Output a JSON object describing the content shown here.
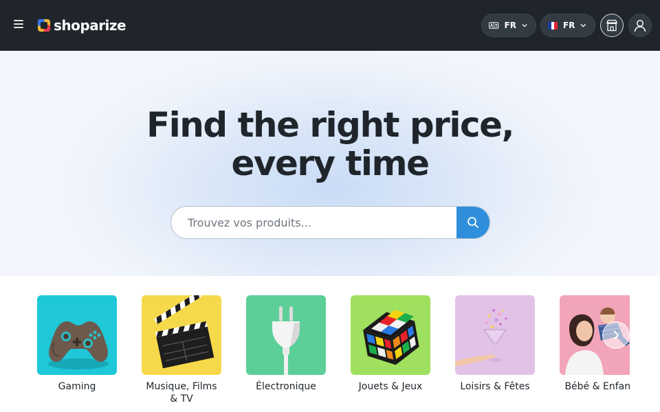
{
  "header": {
    "logo_text": "shoparize",
    "language": {
      "code": "FR",
      "icon": "translate-icon"
    },
    "country": {
      "code": "FR",
      "flag_colors": [
        "#1f3c9c",
        "#ffffff",
        "#e0242f"
      ]
    },
    "store_icon": "store-icon",
    "account_icon": "user-icon",
    "menu_icon": "hamburger-icon"
  },
  "hero": {
    "title_line1": "Find the right price,",
    "title_line2": "every time",
    "search_placeholder": "Trouvez vos produits...",
    "search_icon": "search-icon"
  },
  "categories": [
    {
      "label": "Gaming",
      "tile_color": "#1ec8d8",
      "icon": "gamepad-icon"
    },
    {
      "label": "Musique, Films & TV",
      "tile_color": "#f6d94a",
      "icon": "clapperboard-icon"
    },
    {
      "label": "Électronique",
      "tile_color": "#5ccf98",
      "icon": "plug-icon"
    },
    {
      "label": "Jouets & Jeux",
      "tile_color": "#9fe05e",
      "icon": "rubiks-cube-icon"
    },
    {
      "label": "Loisirs & Fêtes",
      "tile_color": "#e3c2e8",
      "icon": "party-glass-icon"
    },
    {
      "label": "Bébé & Enfant",
      "tile_color": "#f2a4b8",
      "icon": "baby-icon"
    }
  ],
  "carousel_next_icon": "chevron-right-icon",
  "colors": {
    "header_bg": "#1f252b",
    "accent": "#2f8fdc",
    "text_dark": "#1f252b"
  }
}
